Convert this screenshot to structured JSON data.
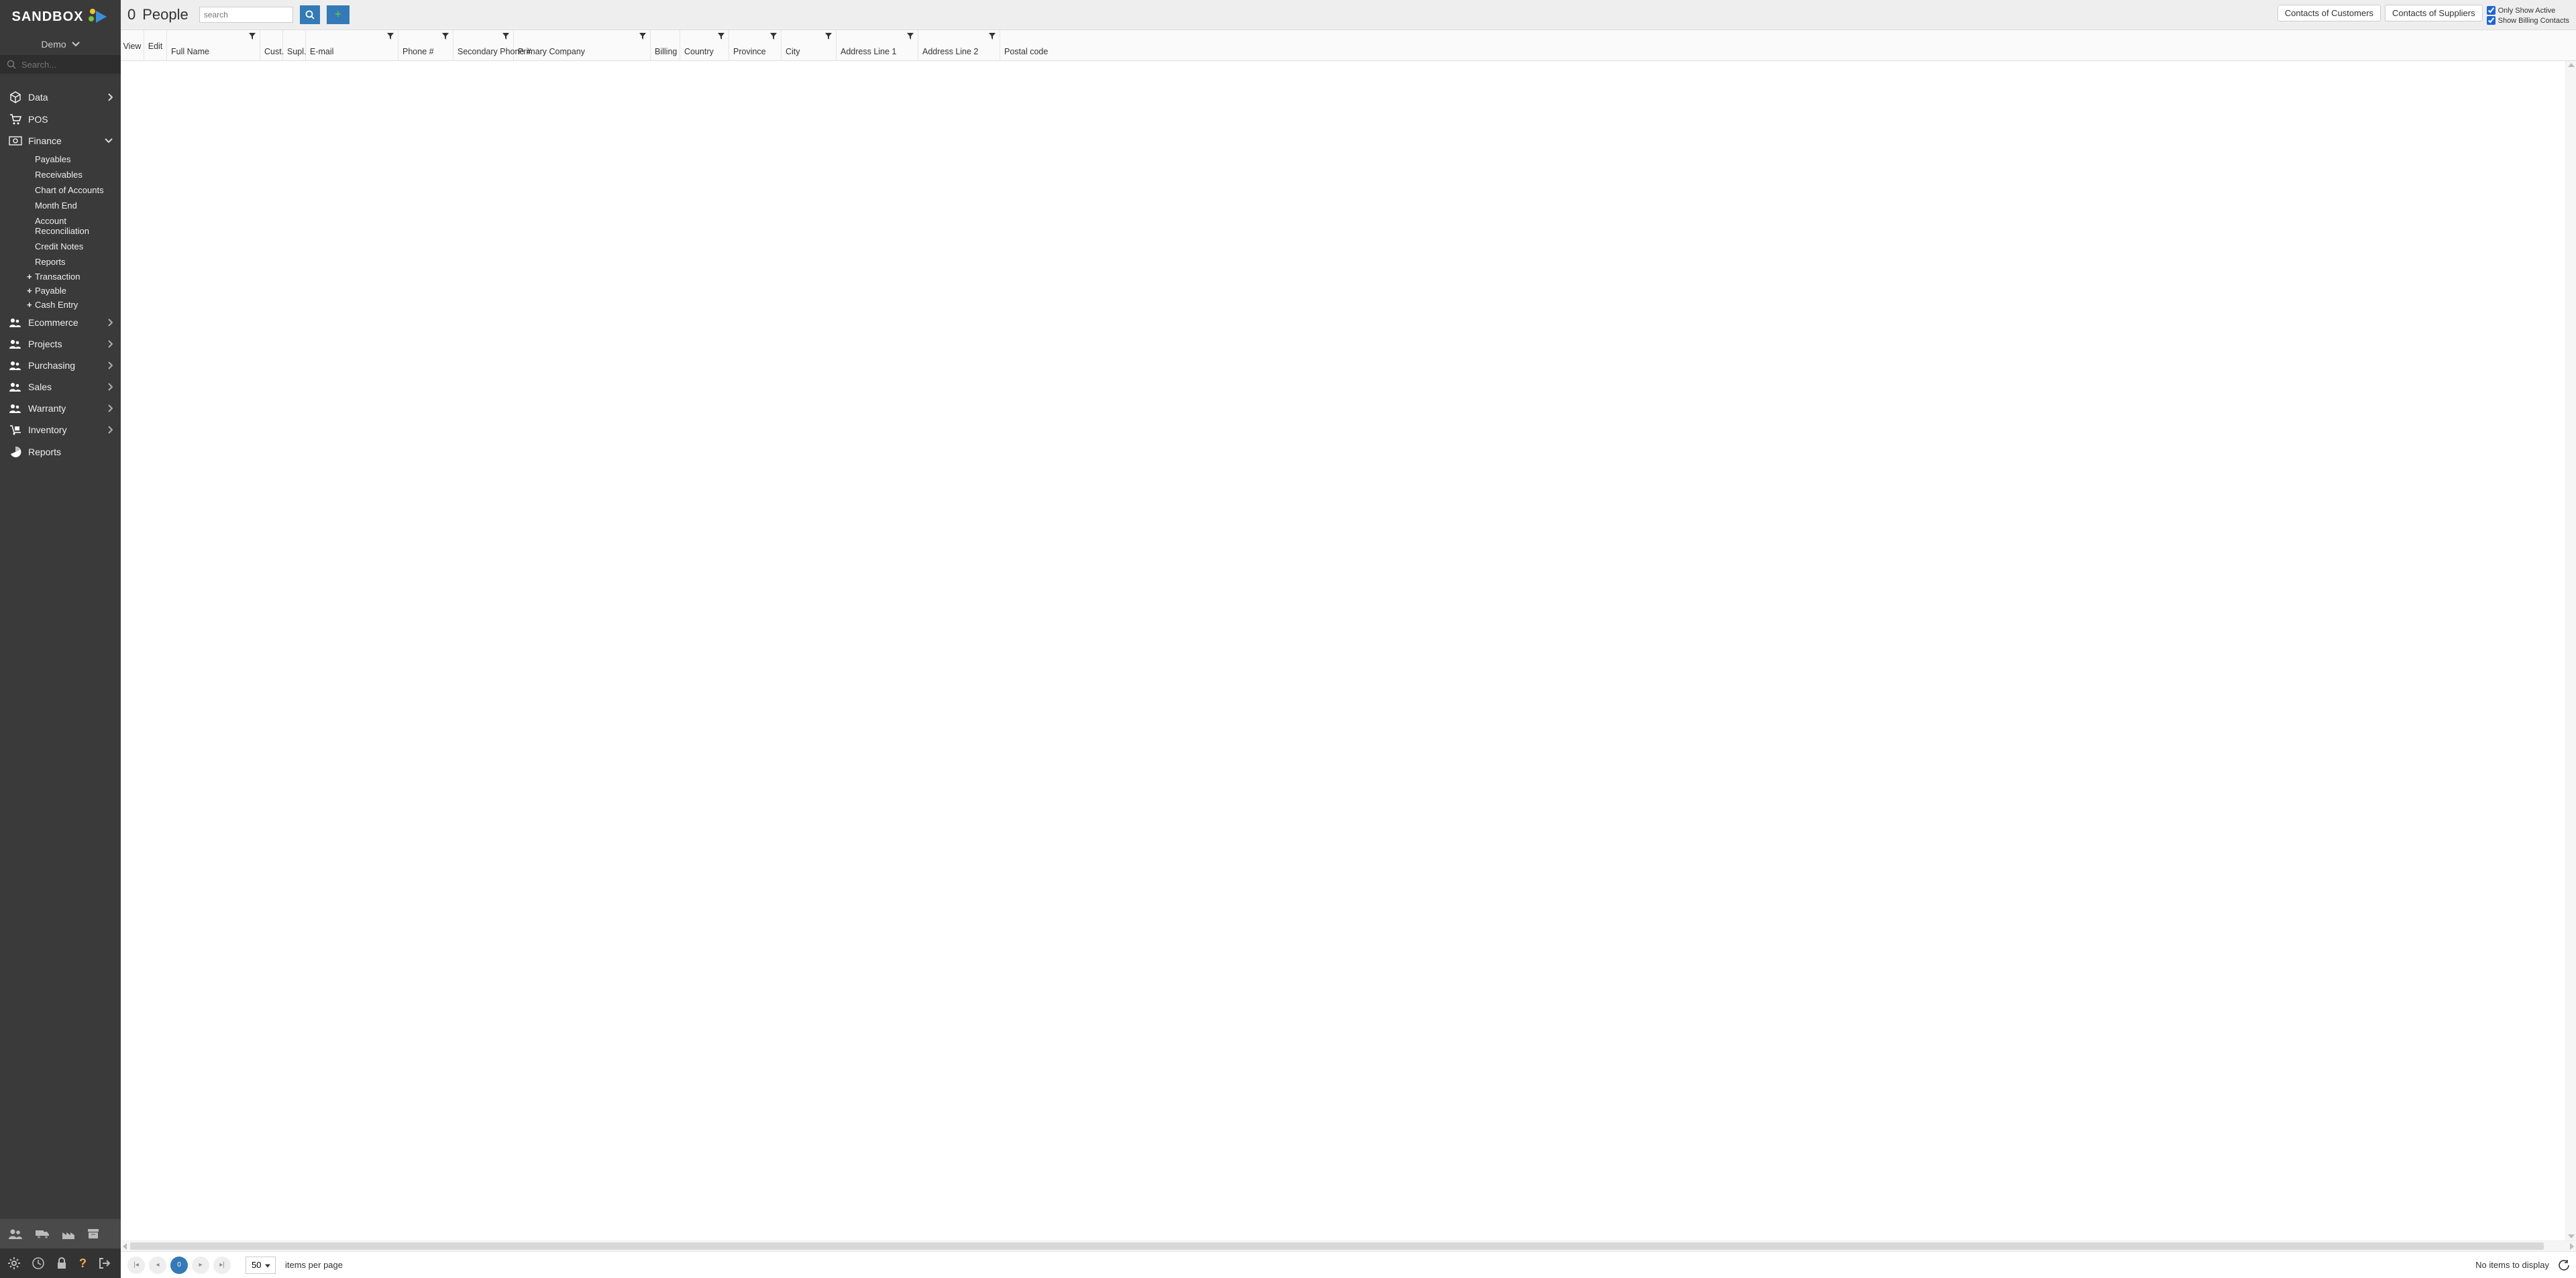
{
  "brand": {
    "name": "SANDBOX"
  },
  "org": {
    "name": "Demo"
  },
  "sidebar_search": {
    "placeholder": "Search..."
  },
  "nav": {
    "data": "Data",
    "pos": "POS",
    "finance": "Finance",
    "finance_sub": {
      "payables": "Payables",
      "receivables": "Receivables",
      "chart": "Chart of Accounts",
      "monthend": "Month End",
      "reconcile": "Account Reconciliation",
      "credit": "Credit Notes",
      "reports": "Reports"
    },
    "finance_plus": {
      "transaction": "Transaction",
      "payable": "Payable",
      "cash": "Cash Entry"
    },
    "ecommerce": "Ecommerce",
    "projects": "Projects",
    "purchasing": "Purchasing",
    "sales": "Sales",
    "warranty": "Warranty",
    "inventory": "Inventory",
    "reports": "Reports"
  },
  "header": {
    "count": "0",
    "title": "People",
    "search_placeholder": "search",
    "btn_customers": "Contacts of Customers",
    "btn_suppliers": "Contacts of Suppliers",
    "chk_active": "Only Show Active",
    "chk_billing": "Show Billing Contacts"
  },
  "columns": {
    "view": "View",
    "edit": "Edit",
    "fullname": "Full Name",
    "cust": "Cust.",
    "supl": "Supl.",
    "email": "E-mail",
    "phone": "Phone #",
    "secphone": "Secondary Phone #",
    "pcompany": "Primary Company",
    "billing": "Billing",
    "country": "Country",
    "province": "Province",
    "city": "City",
    "addr1": "Address Line 1",
    "addr2": "Address Line 2",
    "postal": "Postal code"
  },
  "pager": {
    "current_page": "0",
    "page_size": "50",
    "items_per_page": "items per page",
    "status": "No items to display"
  }
}
